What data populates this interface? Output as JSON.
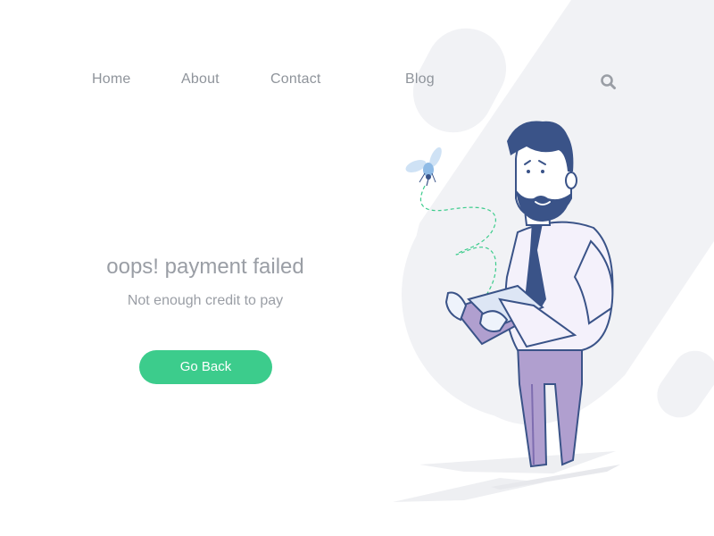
{
  "nav": {
    "items": [
      {
        "label": "Home"
      },
      {
        "label": "About"
      },
      {
        "label": "Contact"
      },
      {
        "label": "Blog"
      }
    ],
    "search_icon": "search-icon"
  },
  "message": {
    "title": "oops! payment failed",
    "subtitle": "Not enough credit to pay"
  },
  "actions": {
    "go_back_label": "Go Back"
  },
  "colors": {
    "accent": "#3ccc8c",
    "text_muted": "#9a9ea5",
    "background_shape": "#f1f2f5",
    "hair_navy": "#3a5388",
    "pants_purple": "#b09fcf"
  },
  "illustration": {
    "subject": "bearded-man-with-empty-wallet",
    "icons": [
      "mosquito-icon"
    ]
  }
}
